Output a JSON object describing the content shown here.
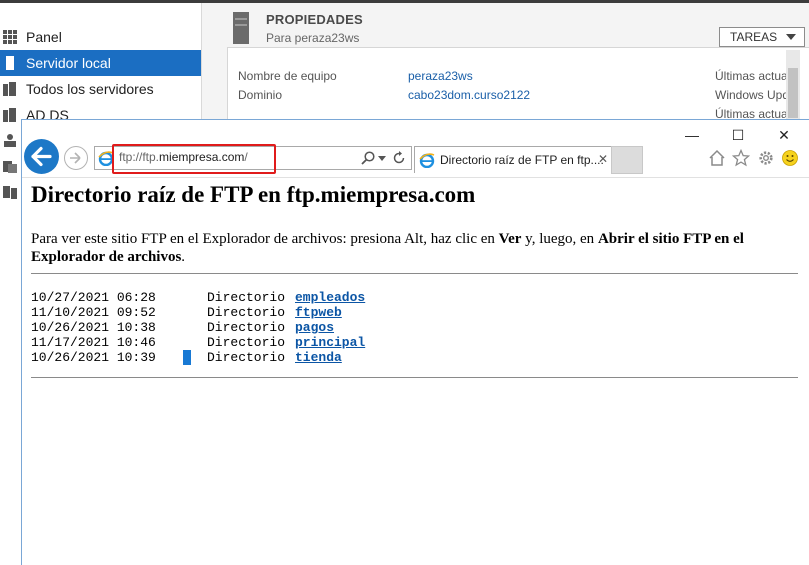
{
  "server_manager": {
    "nav": [
      {
        "label": "Panel",
        "icon": "dashboard-icon",
        "active": false
      },
      {
        "label": "Servidor local",
        "icon": "server-icon",
        "active": true
      },
      {
        "label": "Todos los servidores",
        "icon": "servers-icon",
        "active": false
      },
      {
        "label": "AD DS",
        "icon": "ad-ds-icon",
        "active": false
      }
    ],
    "section_title": "PROPIEDADES",
    "section_subtitle": "Para peraza23ws",
    "tasks_label": "TAREAS",
    "properties": [
      {
        "label": "Nombre de equipo",
        "value": "peraza23ws"
      },
      {
        "label": "Dominio",
        "value": "cabo23dom.curso2122"
      }
    ],
    "right_column": [
      "Últimas actua",
      "Windows Upd",
      "Últimas actua"
    ]
  },
  "browser": {
    "address_prefix": "ftp://ftp.",
    "address_domain": "miempresa.com",
    "address_suffix": "/",
    "tab_title": "Directorio raíz de FTP en ftp....",
    "tab_close": "✕",
    "window_controls": {
      "minimize": "—",
      "maximize": "☐",
      "close": "✕"
    },
    "toolbar_icons": [
      "home-icon",
      "favorites-icon",
      "settings-icon",
      "feedback-smiley-icon"
    ],
    "accent_color": "#1d78c7",
    "highlight_color": "#e01b1b"
  },
  "page": {
    "title": "Directorio raíz de FTP en ftp.miempresa.com",
    "instructions_parts": [
      "Para ver este sitio FTP en el Explorador de archivos: presiona Alt, haz clic en ",
      "Ver",
      " y, luego, en ",
      "Abrir el sitio FTP en el Explorador de archivos",
      "."
    ],
    "entries": [
      {
        "date": "10/27/2021 06:28",
        "kind": "Directorio",
        "name": "empleados"
      },
      {
        "date": "11/10/2021 09:52",
        "kind": "Directorio",
        "name": "ftpweb"
      },
      {
        "date": "10/26/2021 10:38",
        "kind": "Directorio",
        "name": "pagos"
      },
      {
        "date": "11/17/2021 10:46",
        "kind": "Directorio",
        "name": "principal"
      },
      {
        "date": "10/26/2021 10:39",
        "kind": "Directorio",
        "name": "tienda"
      }
    ]
  }
}
